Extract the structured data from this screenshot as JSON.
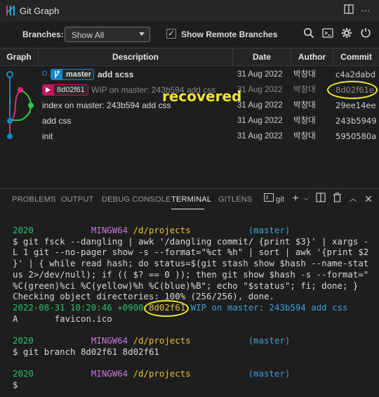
{
  "header": {
    "title": "Git Graph",
    "branches_label": "Branches:",
    "branches_value": "Show All",
    "show_remote_label": "Show Remote Branches",
    "show_remote_checked": true
  },
  "table": {
    "columns": [
      "Graph",
      "Description",
      "Date",
      "Author",
      "Commit"
    ],
    "rows": [
      {
        "ref": "master",
        "description": "add scss",
        "date": "31 Aug 2022",
        "author": "박창대",
        "commit": "c4a2dabd"
      },
      {
        "ref": "8d02f61",
        "description": "WIP on master: 243b594 add css",
        "date": "31 Aug 2022",
        "author": "박창대",
        "commit": "8d02f61e"
      },
      {
        "ref": "",
        "description": "index on master: 243b594 add css",
        "date": "31 Aug 2022",
        "author": "박창대",
        "commit": "29ee14ee"
      },
      {
        "ref": "",
        "description": "add css",
        "date": "31 Aug 2022",
        "author": "박창대",
        "commit": "243b5949"
      },
      {
        "ref": "",
        "description": "init",
        "date": "31 Aug 2022",
        "author": "박창대",
        "commit": "5950580a"
      }
    ]
  },
  "annotation": {
    "text": "recovered",
    "color": "#f2e530"
  },
  "panel": {
    "tabs": [
      "PROBLEMS",
      "OUTPUT",
      "DEBUG CONSOLE",
      "TERMINAL",
      "GITLENS"
    ],
    "active_tab": "TERMINAL",
    "terminal_name": "git"
  },
  "terminal": {
    "prompt1": {
      "user": "2020",
      "host": "MINGW64",
      "path": "/d/projects",
      "branch": "(master)"
    },
    "command1": [
      "$ git fsck --dangling | awk '/dangling commit/ {print $3}' | xargs -",
      "L 1 git --no-pager show -s --format=\"%ct %h\" | sort | awk '{print $2",
      "}' | { while read hash; do status=$(git stash show $hash --name-stat",
      "us 2>/dev/null); if (( $? == 0 )); then git show $hash -s --format=\"",
      "%C(green)%ci %C(yellow)%h %C(blue)%B\"; echo \"$status\"; fi; done; }",
      "Checking object directories: 100% (256/256), done."
    ],
    "result_date": "2022-08-31 10:20:46 +0900",
    "result_hash": "8d02f61",
    "result_msg": "WIP on master: 243b594 add css",
    "result_file_status": "A",
    "result_file": "favicon.ico",
    "prompt2": {
      "user": "2020",
      "host": "MINGW64",
      "path": "/d/projects",
      "branch": "(master)"
    },
    "command2": "$ git branch 8d02f61 8d02f61",
    "prompt3": {
      "user": "2020",
      "host": "MINGW64",
      "path": "/d/projects",
      "branch": "(master)"
    },
    "command3": "$"
  },
  "colors": {
    "master_ref": "#1a86c8",
    "stash_ref": "#c2185b",
    "graph_green": "#2ecc40",
    "highlight": "#f5ea2a"
  }
}
